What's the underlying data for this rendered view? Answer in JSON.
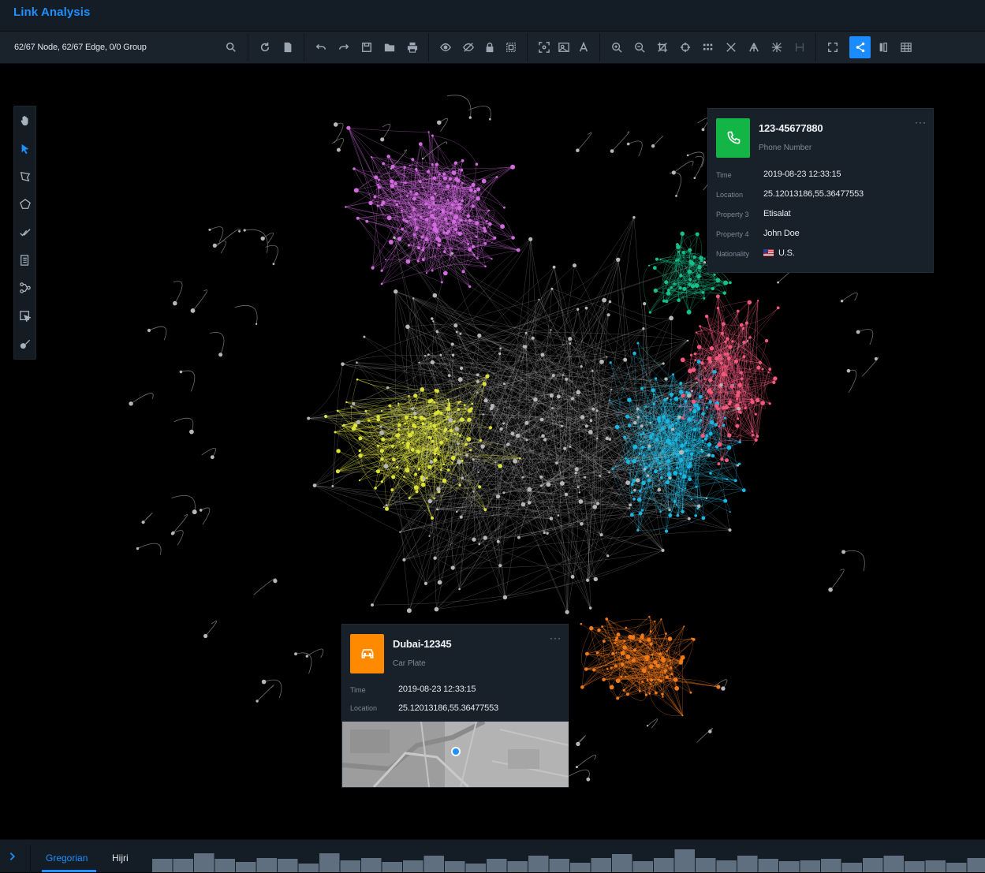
{
  "app": {
    "title": "Link Analysis"
  },
  "toolbar": {
    "stats": "62/67 Node, 62/67 Edge, 0/0 Group",
    "active_tool": "network-layout",
    "buttons": [
      "search-icon",
      "refresh-icon",
      "file-icon",
      "undo-icon",
      "redo-icon",
      "save-icon",
      "open-folder-icon",
      "print-icon",
      "show-icon",
      "hide-icon",
      "lock-icon",
      "group-select-icon",
      "fit-screen-icon",
      "image-icon",
      "text-icon",
      "zoom-in-icon",
      "zoom-out-icon",
      "crop-icon",
      "target-icon",
      "grid-layout-icon",
      "cross-layout-icon",
      "tree-layout-icon",
      "cluster-layout-icon",
      "hierarchy-icon",
      "fullscreen-icon",
      "network-layout-icon",
      "panel-icon",
      "table-icon"
    ]
  },
  "left_tools": {
    "selected": "pointer",
    "items": [
      "hand-icon",
      "pointer-icon",
      "lasso-icon",
      "polygon-icon",
      "check-icon",
      "list-icon",
      "path-icon",
      "select-box-icon",
      "paint-icon"
    ]
  },
  "cards": {
    "phone": {
      "title": "123-45677880",
      "subtitle": "Phone Number",
      "icon": "phone-icon",
      "color": "#14b547",
      "rows": [
        {
          "label": "Time",
          "value": "2019-08-23 12:33:15"
        },
        {
          "label": "Location",
          "value": "25.12013186,55.36477553"
        },
        {
          "label": "Property 3",
          "value": "Etisalat"
        },
        {
          "label": "Property 4",
          "value": "John Doe"
        },
        {
          "label": "Nationality",
          "value": "U.S."
        }
      ],
      "menu": "···"
    },
    "car": {
      "title": "Dubai-12345",
      "subtitle": "Car Plate",
      "icon": "car-icon",
      "color": "#ff8a00",
      "rows": [
        {
          "label": "Time",
          "value": "2019-08-23 12:33:15"
        },
        {
          "label": "Location",
          "value": "25.12013186,55.36477553"
        }
      ],
      "menu": "···"
    }
  },
  "graph_colors": {
    "purple": "#d26ae0",
    "yellow": "#dde23a",
    "cyan": "#19b6e0",
    "pink": "#f0587c",
    "orange": "#f07a1a",
    "green": "#17c08a",
    "gray": "#b7b7b7"
  },
  "timeline": {
    "tabs": [
      {
        "label": "Gregorian",
        "active": true
      },
      {
        "label": "Hijri",
        "active": false
      }
    ],
    "histogram": [
      0.55,
      0.55,
      0.8,
      0.55,
      0.42,
      0.6,
      0.55,
      0.35,
      0.8,
      0.5,
      0.6,
      0.42,
      0.5,
      0.7,
      0.45,
      0.35,
      0.55,
      0.45,
      0.7,
      0.55,
      0.4,
      0.6,
      0.75,
      0.45,
      0.6,
      0.95,
      0.6,
      0.5,
      0.7,
      0.55,
      0.45,
      0.5,
      0.55,
      0.4,
      0.6,
      0.7,
      0.45,
      0.5,
      0.4,
      0.6,
      0.55,
      0.45,
      0.5,
      0.7,
      0.55,
      0.4,
      0.5,
      0.45,
      0.6,
      0.5,
      0.7,
      0.55
    ]
  }
}
